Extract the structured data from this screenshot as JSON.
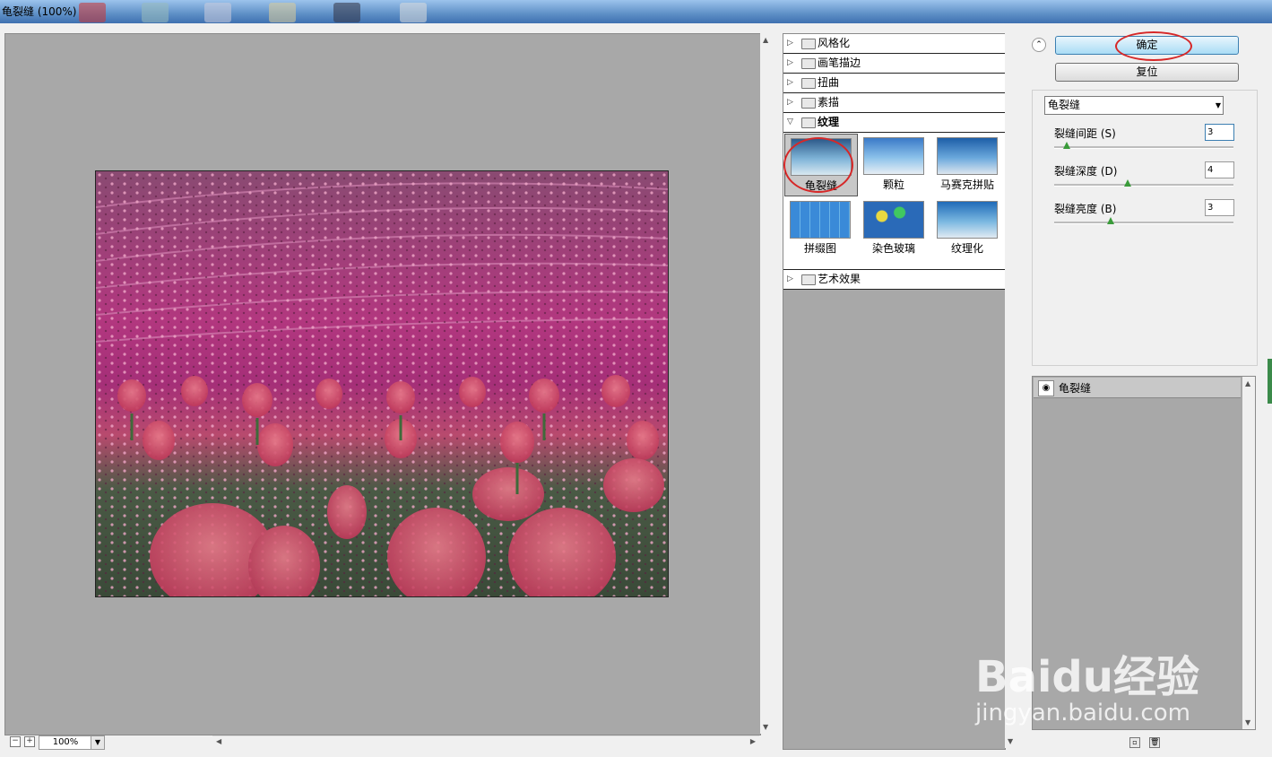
{
  "window": {
    "title": "龟裂缝 (100%)"
  },
  "buttons": {
    "ok": "确定",
    "reset": "复位"
  },
  "categories_top": [
    "风格化",
    "画笔描边",
    "扭曲",
    "素描"
  ],
  "open_category": "纹理",
  "thumbnails": [
    {
      "label": "龟裂缝",
      "selected": true
    },
    {
      "label": "颗粒",
      "selected": false
    },
    {
      "label": "马赛克拼贴",
      "selected": false
    },
    {
      "label": "拼缀图",
      "selected": false
    },
    {
      "label": "染色玻璃",
      "selected": false
    },
    {
      "label": "纹理化",
      "selected": false
    }
  ],
  "categories_bottom": [
    "艺术效果"
  ],
  "filter_select": {
    "value": "龟裂缝"
  },
  "params": [
    {
      "label": "裂缝间距 (S)",
      "value": "3",
      "level": 0.04
    },
    {
      "label": "裂缝深度 (D)",
      "value": "4",
      "level": 0.4
    },
    {
      "label": "裂缝亮度 (B)",
      "value": "3",
      "level": 0.3
    }
  ],
  "layer": {
    "name": "龟裂缝"
  },
  "zoom": {
    "value": "100%"
  },
  "watermark": {
    "main": "Baidu经验",
    "sub": "jingyan.baidu.com"
  },
  "colors": {
    "accent_circle": "#d62828",
    "ok_button": "#a9dcf5",
    "canvas_bg": "#a8a8a8"
  }
}
